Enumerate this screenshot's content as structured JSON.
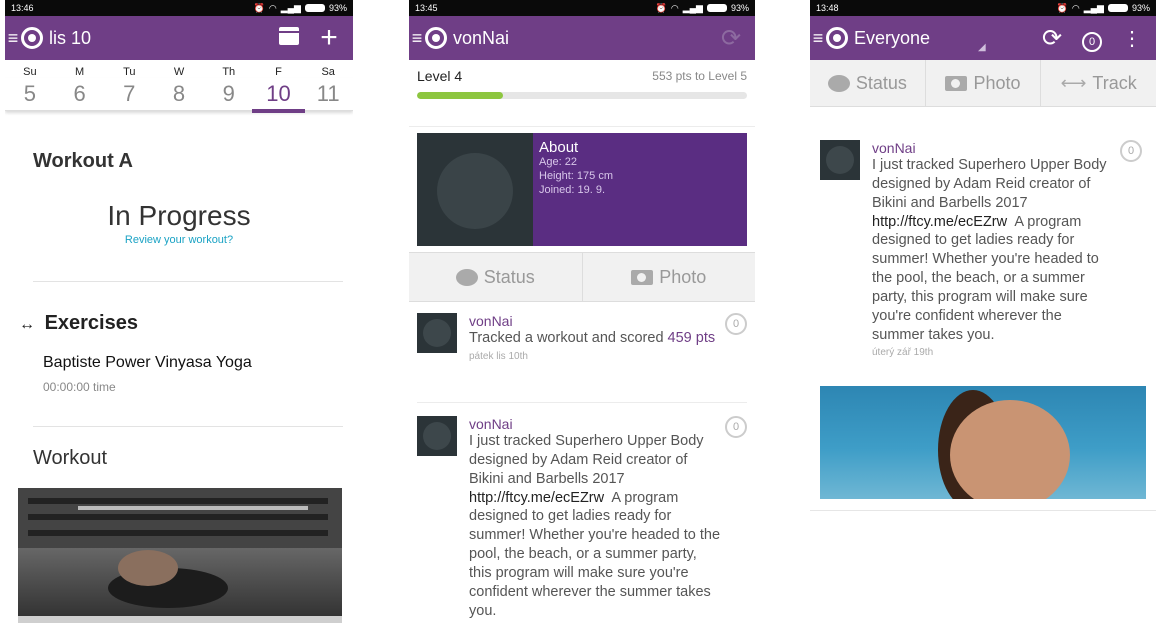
{
  "screen1": {
    "status": {
      "time": "13:46",
      "battery": "93%"
    },
    "appbar": {
      "title": "lis 10",
      "add_icon": "+"
    },
    "calendar": {
      "days": [
        "Su",
        "M",
        "Tu",
        "W",
        "Th",
        "F",
        "Sa"
      ],
      "dates": [
        "5",
        "6",
        "7",
        "8",
        "9",
        "10",
        "11"
      ],
      "selected_index": 5
    },
    "workout_title": "Workout A",
    "status_text": "In Progress",
    "review_link": "Review your workout?",
    "exercises_icon": "↔",
    "exercises_title": "Exercises",
    "exercise": {
      "name": "Baptiste Power Vinyasa Yoga",
      "time": "00:00:00 time"
    },
    "workout_section": "Workout"
  },
  "screen2": {
    "status": {
      "time": "13:45",
      "battery": "93%"
    },
    "appbar": {
      "title": "vonNai"
    },
    "level": {
      "label": "Level",
      "value": "4",
      "to_next": "553 pts to Level 5",
      "progress_fraction": 0.26
    },
    "about": {
      "title": "About",
      "age_label": "Age:",
      "age": "22",
      "height_label": "Height:",
      "height": "175 cm",
      "joined_label": "Joined:",
      "joined": "19. 9."
    },
    "tabs": {
      "status": "Status",
      "photo": "Photo"
    },
    "posts": [
      {
        "user": "vonNai",
        "text_pre": "Tracked a workout and scored",
        "points": "459",
        "points_suffix": "pts",
        "date": "pátek lis 10th",
        "count": "0"
      },
      {
        "user": "vonNai",
        "text": "I just tracked Superhero Upper Body designed by Adam Reid creator of Bikini and Barbells 2017",
        "url": "http://ftcy.me/ecEZrw",
        "text2": "A program designed to get ladies ready for summer! Whether you're headed to the pool, the beach, or a summer party, this program will make sure you're confident wherever the summer takes you.",
        "count": "0"
      }
    ]
  },
  "screen3": {
    "status": {
      "time": "13:48",
      "battery": "93%"
    },
    "appbar": {
      "title": "Everyone",
      "count": "0"
    },
    "tabs": {
      "status": "Status",
      "photo": "Photo",
      "track": "Track"
    },
    "post": {
      "user": "vonNai",
      "text": "I just tracked Superhero Upper Body designed by Adam Reid creator of Bikini and Barbells 2017",
      "url": "http://ftcy.me/ecEZrw",
      "text2": "A program designed to get ladies ready for summer! Whether you're headed to the pool, the beach, or a summer party, this program will make sure you're confident wherever the summer takes you.",
      "date": "úterý zář 19th",
      "count": "0"
    }
  },
  "colors": {
    "brand": "#6f3e86",
    "about_bg": "#5a2d82",
    "progress": "#8dc63f",
    "link": "#1aa2c4"
  }
}
